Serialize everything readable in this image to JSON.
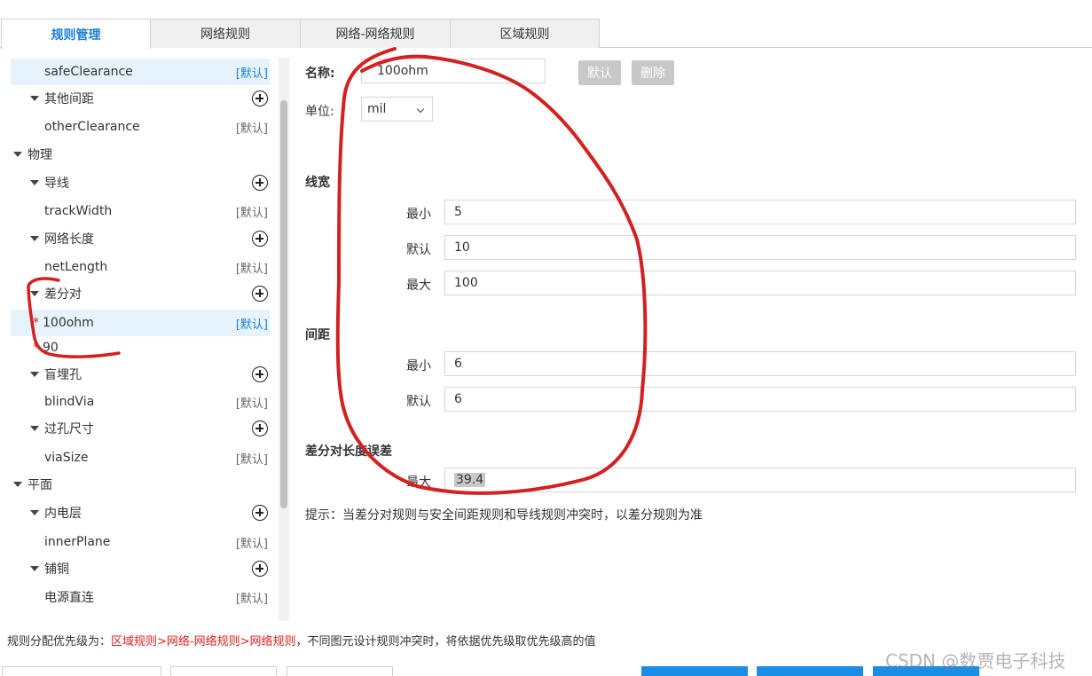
{
  "tabs": [
    {
      "label": "规则管理",
      "active": true
    },
    {
      "label": "网络规则",
      "active": false
    },
    {
      "label": "网络-网络规则",
      "active": false
    },
    {
      "label": "区域规则",
      "active": false
    }
  ],
  "tree": {
    "default_tag": "[默认]",
    "items": [
      {
        "label": "safeClearance",
        "type": "leaf",
        "tag": "[默认]",
        "selected": true
      },
      {
        "label": "其他间距",
        "type": "group"
      },
      {
        "label": "otherClearance",
        "type": "leaf",
        "tag": "[默认]"
      },
      {
        "label": "物理",
        "type": "category"
      },
      {
        "label": "导线",
        "type": "group"
      },
      {
        "label": "trackWidth",
        "type": "leaf",
        "tag": "[默认]"
      },
      {
        "label": "网络长度",
        "type": "group"
      },
      {
        "label": "netLength",
        "type": "leaf",
        "tag": "[默认]"
      },
      {
        "label": "差分对",
        "type": "group"
      },
      {
        "label": "100ohm",
        "type": "leaf",
        "tag": "[默认]",
        "selected": true,
        "starred": true
      },
      {
        "label": "90",
        "type": "leaf",
        "starred": true
      },
      {
        "label": "盲埋孔",
        "type": "group"
      },
      {
        "label": "blindVia",
        "type": "leaf",
        "tag": "[默认]"
      },
      {
        "label": "过孔尺寸",
        "type": "group"
      },
      {
        "label": "viaSize",
        "type": "leaf",
        "tag": "[默认]"
      },
      {
        "label": "平面",
        "type": "category"
      },
      {
        "label": "内电层",
        "type": "group"
      },
      {
        "label": "innerPlane",
        "type": "leaf",
        "tag": "[默认]"
      },
      {
        "label": "铺铜",
        "type": "group"
      },
      {
        "label": "电源直连",
        "type": "leaf",
        "tag": "[默认]"
      }
    ]
  },
  "form": {
    "name_label": "名称:",
    "name_value": "100ohm",
    "default_button": "默认",
    "delete_button": "删除",
    "unit_label": "单位:",
    "unit_value": "mil",
    "track_width": {
      "title": "线宽",
      "min_label": "最小",
      "min_value": "5",
      "default_label": "默认",
      "default_value": "10",
      "max_label": "最大",
      "max_value": "100"
    },
    "spacing": {
      "title": "间距",
      "min_label": "最小",
      "min_value": "6",
      "default_label": "默认",
      "default_value": "6"
    },
    "diff_length": {
      "title": "差分对长度误差",
      "max_label": "最大",
      "max_value": "39.4"
    },
    "hint": "提示：当差分对规则与安全间距规则和导线规则冲突时，以差分规则为准"
  },
  "footer": {
    "prefix": "规则分配优先级为：",
    "priority": "区域规则>网络-网络规则>网络规则",
    "suffix": "，不同图元设计规则冲突时，将依据优先级取优先级高的值"
  },
  "watermark": "CSDN @数贾电子科技",
  "colors": {
    "accent": "#1a7fd4",
    "annotation": "#d42020",
    "star": "#e02020"
  }
}
